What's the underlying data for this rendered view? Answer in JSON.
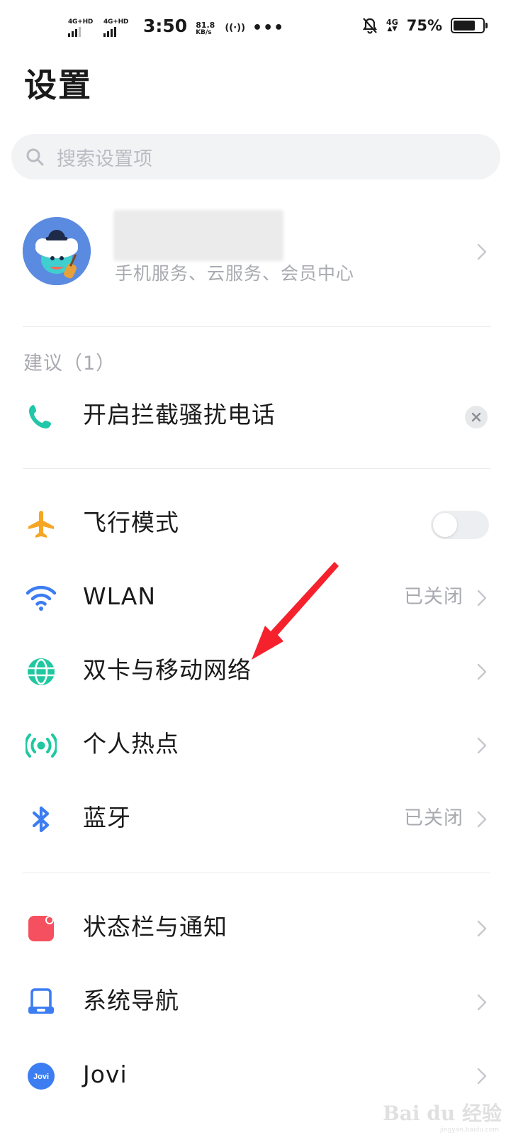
{
  "status_bar": {
    "sim1_label": "4G+HD",
    "sim2_label": "4G+HD",
    "time": "3:50",
    "speed_value": "81.8",
    "speed_unit": "KB/s",
    "nfc_glyph": "((·))",
    "more_glyph": "•••",
    "network_label": "4G",
    "network_arrows": "▲▼",
    "battery_percent": "75%",
    "battery_level": 0.75,
    "icons": [
      "signal-icon",
      "signal-icon",
      "hotspot-icon",
      "more-icon",
      "mute-bell-icon",
      "battery-icon"
    ]
  },
  "header": {
    "title": "设置"
  },
  "search": {
    "placeholder": "搜索设置项",
    "icon": "search-icon"
  },
  "account": {
    "subtitle": "手机服务、云服务、会员中心",
    "icon": "avatar"
  },
  "suggestions": {
    "label": "建议（1）",
    "items": [
      {
        "label": "开启拦截骚扰电话",
        "icon": "phone-icon",
        "color": "#21c7a8"
      }
    ]
  },
  "connectivity": [
    {
      "label": "飞行模式",
      "icon": "airplane-icon",
      "color": "#f5a623",
      "toggle": false
    },
    {
      "label": "WLAN",
      "icon": "wifi-icon",
      "color": "#3d7df2",
      "value": "已关闭"
    },
    {
      "label": "双卡与移动网络",
      "icon": "globe-icon",
      "color": "#1fc8a0"
    },
    {
      "label": "个人热点",
      "icon": "hotspot-icon",
      "color": "#1fc8a0"
    },
    {
      "label": "蓝牙",
      "icon": "bluetooth-icon",
      "color": "#3d7df2",
      "value": "已关闭"
    }
  ],
  "system": [
    {
      "label": "状态栏与通知",
      "icon": "notification-icon",
      "color": "#f5505f"
    },
    {
      "label": "系统导航",
      "icon": "navigation-icon",
      "color": "#3d7df2"
    },
    {
      "label": "Jovi",
      "icon": "jovi-icon",
      "color": "#3d7df2",
      "badge": "Jovi"
    }
  ],
  "annotation": {
    "color": "#f5222d"
  },
  "watermark": {
    "text": "Bai du 经验",
    "sub": "jingyan.baidu.com"
  }
}
